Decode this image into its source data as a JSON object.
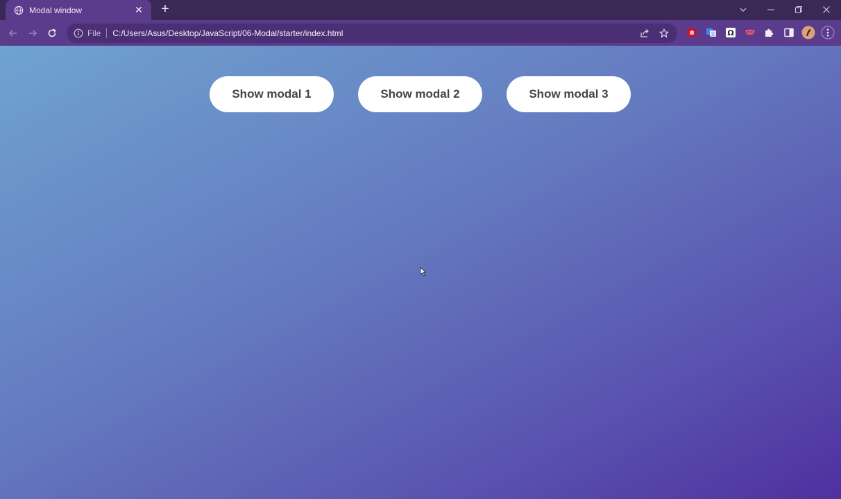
{
  "browser": {
    "tab": {
      "title": "Modal window",
      "icon": "globe-icon"
    },
    "address": {
      "scheme_label": "File",
      "url": "C:/Users/Asus/Desktop/JavaScript/06-Modal/starter/index.html"
    },
    "extensions": [
      "hand-icon",
      "translate-icon",
      "omega-icon",
      "mask-icon",
      "puzzle-icon",
      "sidepanel-icon",
      "profile-avatar"
    ],
    "colors": {
      "tabstrip": "#3a2857",
      "toolbar": "#5b3b8c",
      "omnibox": "#4a2f75"
    }
  },
  "page": {
    "buttons": [
      {
        "label": "Show modal 1"
      },
      {
        "label": "Show modal 2"
      },
      {
        "label": "Show modal 3"
      }
    ],
    "colors": {
      "gradient_start": "#6fa3d1",
      "gradient_end": "#4f30a0",
      "button_bg": "#ffffff",
      "button_text": "#444444"
    }
  }
}
